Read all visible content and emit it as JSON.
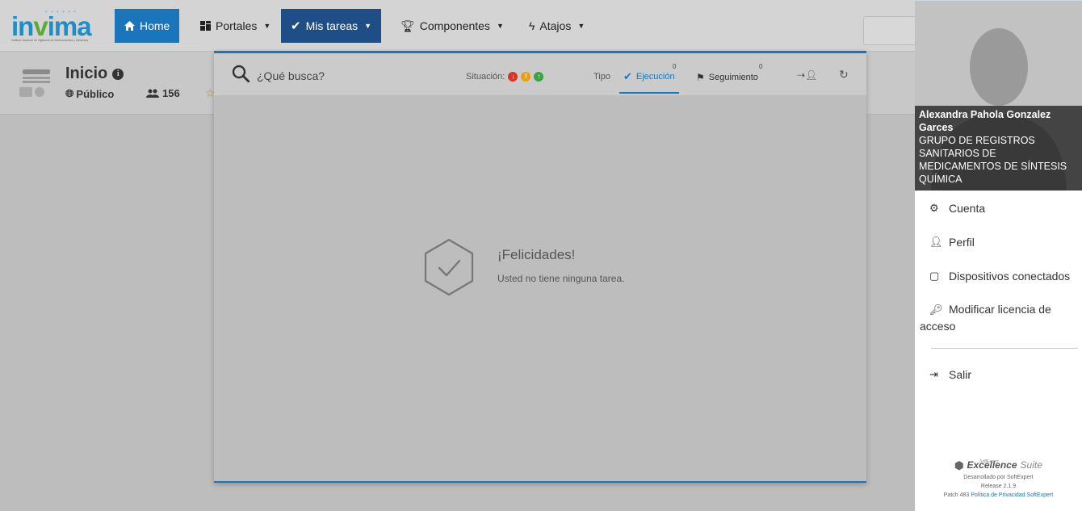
{
  "brand": {
    "logo_text": "invima",
    "logo_subtitle": "Instituto Nacional de Vigilancia de Medicamentos y Alimentos"
  },
  "navbar": {
    "home": "Home",
    "portales": "Portales",
    "mis_tareas": "Mis tareas",
    "componentes": "Componentes",
    "atajos": "Atajos"
  },
  "subheader": {
    "title": "Inicio",
    "visibility": "Público",
    "users_count": "156"
  },
  "task_panel": {
    "search_placeholder": "¿Qué busca?",
    "situacion_label": "Situación:",
    "tipo_label": "Tipo",
    "tab_ejecucion": "Ejecución",
    "tab_ejecucion_count": "0",
    "tab_seguimiento": "Seguimiento",
    "tab_seguimiento_count": "0",
    "empty_title": "¡Felicidades!",
    "empty_text": "Usted no tiene ninguna tarea."
  },
  "user": {
    "name": "Alexandra Pahola Gonzalez Garces",
    "group": "GRUPO DE REGISTROS SANITARIOS DE MEDICAMENTOS DE SÍNTESIS QUÍMICA"
  },
  "user_menu": {
    "cuenta": "Cuenta",
    "perfil": "Perfil",
    "dispositivos": "Dispositivos conectados",
    "licencia": "Modificar licencia de acceso",
    "salir": "Salir"
  },
  "footer": {
    "brand_small": "SoftExpert",
    "brand_main": "Excellence",
    "brand_suite": "Suite",
    "developed_by": "Desarrollado por SoftExpert",
    "release": "Release 2.1.9",
    "patch": "Patch 483",
    "privacy_link": "Política de Privacidad SoftExpert"
  },
  "colors": {
    "primary": "#1b75bb",
    "nav_active": "#1f4e86",
    "status_red": "#d9332b",
    "status_yellow": "#e3a118",
    "status_green": "#3ba24a"
  }
}
